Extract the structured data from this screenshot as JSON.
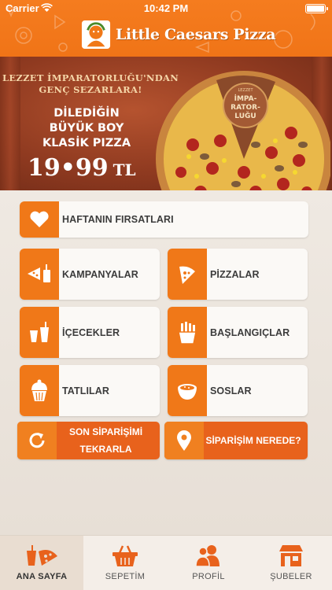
{
  "status_bar": {
    "carrier": "Carrier",
    "time": "10:42 PM"
  },
  "header": {
    "brand_name": "Little Caesars Pizza",
    "logo_icon": "little-caesars-logo-icon"
  },
  "banner": {
    "tagline_line1": "LEZZET İMPARATORLUĞU'NDAN",
    "tagline_line2": "GENÇ SEZARLARA!",
    "offer_line1": "DİLEDİĞİN",
    "offer_line2": "BÜYÜK BOY",
    "offer_line3": "KLASİK PIZZA",
    "price": "19•99",
    "currency": "TL",
    "seal_top": "LEZZET",
    "seal_line1": "İMPA-",
    "seal_line2": "RATOR-",
    "seal_line3": "LUĞU"
  },
  "menu": {
    "deals": {
      "label": "HAFTANIN FIRSATLARI",
      "icon": "heart-icon"
    },
    "campaigns": {
      "label": "KAMPANYALAR",
      "icon": "pizza-drink-icon"
    },
    "pizzas": {
      "label": "PİZZALAR",
      "icon": "pizza-slice-icon"
    },
    "drinks": {
      "label": "İÇECEKLER",
      "icon": "drinks-icon"
    },
    "starters": {
      "label": "BAŞLANGIÇLAR",
      "icon": "fries-icon"
    },
    "desserts": {
      "label": "TATLILAR",
      "icon": "cupcake-icon"
    },
    "sauces": {
      "label": "SOSLAR",
      "icon": "sauce-bowl-icon"
    }
  },
  "actions": {
    "reorder_line1": "SON SİPARİŞİMİ",
    "reorder_line2": "TEKRARLA",
    "reorder_icon": "refresh-icon",
    "track": "SİPARİŞİM NEREDE?",
    "track_icon": "location-pin-icon"
  },
  "tabs": [
    {
      "label": "ANA SAYFA",
      "icon": "home-food-icon",
      "active": true
    },
    {
      "label": "SEPETİM",
      "icon": "basket-icon",
      "active": false
    },
    {
      "label": "PROFİL",
      "icon": "users-icon",
      "active": false
    },
    {
      "label": "ŞUBELER",
      "icon": "store-icon",
      "active": false
    }
  ],
  "colors": {
    "brand_orange": "#f07818",
    "action_orange": "#e8621c",
    "banner_red": "#8f3a20"
  }
}
